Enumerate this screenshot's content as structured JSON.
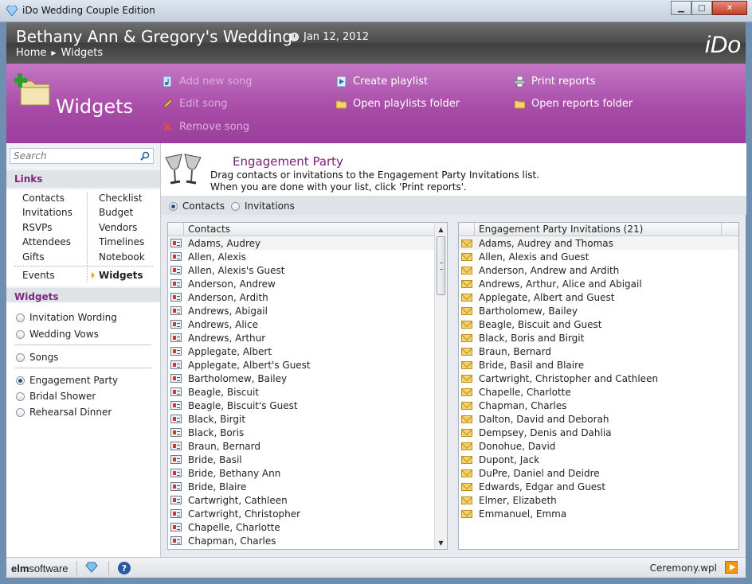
{
  "window": {
    "title": "iDo Wedding Couple Edition",
    "minimize": "▁",
    "maximize": "□",
    "close": "✕"
  },
  "header": {
    "title": "Bethany Ann & Gregory's Wedding",
    "date": "Jan 12, 2012",
    "breadcrumb": [
      "Home",
      "Widgets"
    ],
    "logo": "iDo"
  },
  "toolbar": {
    "heading": "Widgets",
    "add_song": "Add new song",
    "edit_song": "Edit song",
    "remove_song": "Remove song",
    "create_playlist": "Create playlist",
    "open_playlists": "Open playlists folder",
    "print_reports": "Print reports",
    "open_reports": "Open reports folder"
  },
  "sidebar": {
    "search_placeholder": "Search",
    "links_heading": "Links",
    "links_left": [
      "Contacts",
      "Invitations",
      "RSVPs",
      "Attendees",
      "Gifts"
    ],
    "links_right": [
      "Checklist",
      "Budget",
      "Vendors",
      "Timelines",
      "Notebook"
    ],
    "events": "Events",
    "widgets_link": "Widgets",
    "widgets_heading": "Widgets",
    "widgets": {
      "invitation_wording": "Invitation Wording",
      "wedding_vows": "Wedding Vows",
      "songs": "Songs",
      "engagement_party": "Engagement Party",
      "bridal_shower": "Bridal Shower",
      "rehearsal_dinner": "Rehearsal Dinner"
    }
  },
  "main": {
    "title": "Engagement Party",
    "description_line1": "Drag contacts or invitations to the Engagement Party Invitations list.",
    "description_line2": "When you are done with your list, click 'Print reports'.",
    "filter_contacts": "Contacts",
    "filter_invitations": "Invitations",
    "contacts_header": "Contacts",
    "invites_header": "Engagement Party Invitations (21)",
    "contacts": [
      "Adams, Audrey",
      "Allen, Alexis",
      "Allen, Alexis's Guest",
      "Anderson, Andrew",
      "Anderson, Ardith",
      "Andrews, Abigail",
      "Andrews, Alice",
      "Andrews, Arthur",
      "Applegate, Albert",
      "Applegate, Albert's Guest",
      "Bartholomew, Bailey",
      "Beagle, Biscuit",
      "Beagle, Biscuit's Guest",
      "Black, Birgit",
      "Black, Boris",
      "Braun, Bernard",
      "Bride, Basil",
      "Bride, Bethany Ann",
      "Bride, Blaire",
      "Cartwright, Cathleen",
      "Cartwright, Christopher",
      "Chapelle, Charlotte",
      "Chapman, Charles"
    ],
    "invitations": [
      "Adams, Audrey and Thomas",
      "Allen, Alexis and Guest",
      "Anderson, Andrew and Ardith",
      "Andrews, Arthur, Alice and Abigail",
      "Applegate, Albert and Guest",
      "Bartholomew, Bailey",
      "Beagle, Biscuit and Guest",
      "Black, Boris and Birgit",
      "Braun, Bernard",
      "Bride, Basil and Blaire",
      "Cartwright, Christopher and Cathleen",
      "Chapelle, Charlotte",
      "Chapman, Charles",
      "Dalton, David and Deborah",
      "Dempsey, Denis and Dahlia",
      "Donohue, David",
      "Dupont, Jack",
      "DuPre, Daniel and Deidre",
      "Edwards, Edgar and Guest",
      "Elmer, Elizabeth",
      "Emmanuel, Emma"
    ]
  },
  "statusbar": {
    "brand_bold": "elm",
    "brand_rest": "software",
    "help": "?",
    "file": "Ceremony.wpl"
  }
}
